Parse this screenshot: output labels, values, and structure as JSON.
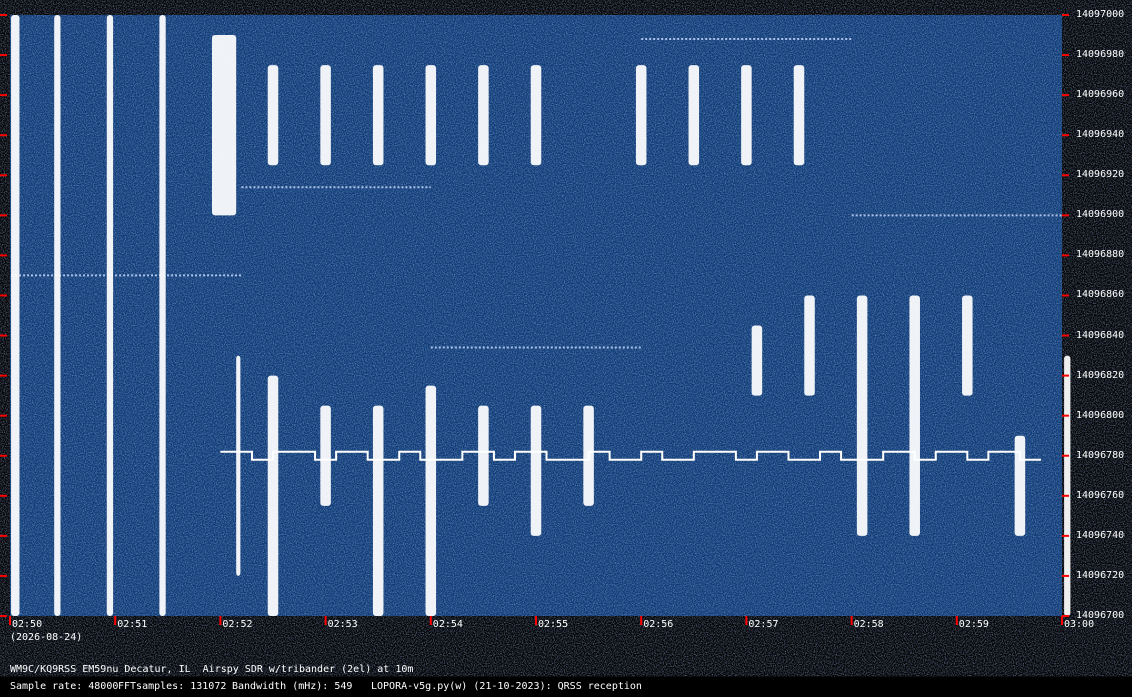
{
  "chart_data": {
    "type": "heatmap",
    "title": "WM9C/KQ9RSS EM59nu Decatur, IL  Airspy SDR w/tribander (2el) at 10m",
    "date": "(2026-08-24)",
    "time_ticks": [
      "02:50",
      "02:51",
      "02:52",
      "02:53",
      "02:54",
      "02:55",
      "02:56",
      "02:57",
      "02:58",
      "02:59",
      "03:00"
    ],
    "freq_ticks": [
      "14097000",
      "14096980",
      "14096960",
      "14096940",
      "14096920",
      "14096900",
      "14096880",
      "14096860",
      "14096840",
      "14096820",
      "14096800",
      "14096780",
      "14096760",
      "14096740",
      "14096720",
      "14096700"
    ],
    "freq_range": [
      14096700,
      14097000
    ],
    "time_range": [
      "02:50",
      "03:00"
    ],
    "colors": {
      "background": "#0e3a74",
      "signal": "#ffffff",
      "tick_mark": "#ff0000"
    },
    "signals": [
      {
        "t0": 0.1,
        "t1": 0.9,
        "f0": 14096700,
        "f1": 14097000
      },
      {
        "t0": 4.2,
        "t1": 4.8,
        "f0": 14096700,
        "f1": 14097000
      },
      {
        "t0": 9.2,
        "t1": 9.8,
        "f0": 14096700,
        "f1": 14097000
      },
      {
        "t0": 14.2,
        "t1": 14.8,
        "f0": 14096700,
        "f1": 14097000
      },
      {
        "t0": 19.2,
        "t1": 21.5,
        "f0": 14096900,
        "f1": 14096990
      },
      {
        "t0": 21.5,
        "t1": 21.9,
        "f0": 14096720,
        "f1": 14096830
      },
      {
        "t0": 24.5,
        "t1": 25.5,
        "f0": 14096925,
        "f1": 14096975
      },
      {
        "t0": 29.5,
        "t1": 30.5,
        "f0": 14096925,
        "f1": 14096975
      },
      {
        "t0": 34.5,
        "t1": 35.5,
        "f0": 14096925,
        "f1": 14096975
      },
      {
        "t0": 39.5,
        "t1": 40.5,
        "f0": 14096925,
        "f1": 14096975
      },
      {
        "t0": 44.5,
        "t1": 45.5,
        "f0": 14096925,
        "f1": 14096975
      },
      {
        "t0": 49.5,
        "t1": 50.5,
        "f0": 14096925,
        "f1": 14096975
      },
      {
        "t0": 59.5,
        "t1": 60.5,
        "f0": 14096925,
        "f1": 14096975
      },
      {
        "t0": 64.5,
        "t1": 65.5,
        "f0": 14096925,
        "f1": 14096975
      },
      {
        "t0": 69.5,
        "t1": 70.5,
        "f0": 14096925,
        "f1": 14096975
      },
      {
        "t0": 74.5,
        "t1": 75.5,
        "f0": 14096925,
        "f1": 14096975
      },
      {
        "t0": 24.5,
        "t1": 25.5,
        "f0": 14096700,
        "f1": 14096820
      },
      {
        "t0": 29.5,
        "t1": 30.5,
        "f0": 14096755,
        "f1": 14096805
      },
      {
        "t0": 34.5,
        "t1": 35.5,
        "f0": 14096700,
        "f1": 14096805
      },
      {
        "t0": 39.5,
        "t1": 40.5,
        "f0": 14096700,
        "f1": 14096815
      },
      {
        "t0": 44.5,
        "t1": 45.5,
        "f0": 14096755,
        "f1": 14096805
      },
      {
        "t0": 49.5,
        "t1": 50.5,
        "f0": 14096740,
        "f1": 14096805
      },
      {
        "t0": 54.5,
        "t1": 55.5,
        "f0": 14096755,
        "f1": 14096805
      },
      {
        "t0": 70.5,
        "t1": 71.5,
        "f0": 14096810,
        "f1": 14096845
      },
      {
        "t0": 75.5,
        "t1": 76.5,
        "f0": 14096810,
        "f1": 14096860
      },
      {
        "t0": 80.5,
        "t1": 81.5,
        "f0": 14096740,
        "f1": 14096860
      },
      {
        "t0": 85.5,
        "t1": 86.5,
        "f0": 14096740,
        "f1": 14096860
      },
      {
        "t0": 90.5,
        "t1": 91.5,
        "f0": 14096810,
        "f1": 14096860
      },
      {
        "t0": 95.5,
        "t1": 96.5,
        "f0": 14096740,
        "f1": 14096790
      },
      {
        "t0": 100.2,
        "t1": 100.8,
        "f0": 14096700,
        "f1": 14096830
      }
    ],
    "carriers": [
      {
        "t0": 0.1,
        "t1": 22.0,
        "f": 14096870
      },
      {
        "t0": 22.0,
        "t1": 40.0,
        "f": 14096914
      },
      {
        "t0": 40.0,
        "t1": 60.0,
        "f": 14096834
      },
      {
        "t0": 60.0,
        "t1": 80.0,
        "f": 14096988
      },
      {
        "t0": 80.0,
        "t1": 100.0,
        "f": 14096900
      }
    ],
    "fsk_trace": {
      "t0": 20.0,
      "t1": 98.0,
      "f_hi": 14096782,
      "f_lo": 14096778
    }
  },
  "footer": {
    "station": "WM9C/KQ9RSS EM59nu Decatur, IL  Airspy SDR w/tribander (2el) at 10m",
    "sample_rate": "Sample rate: 48000",
    "fft_samples": "FFTsamples: 131072",
    "bandwidth": "Bandwidth (mHz): 549",
    "software": "LOPORA-v5g.py(w) (21-10-2023): QRSS reception"
  }
}
